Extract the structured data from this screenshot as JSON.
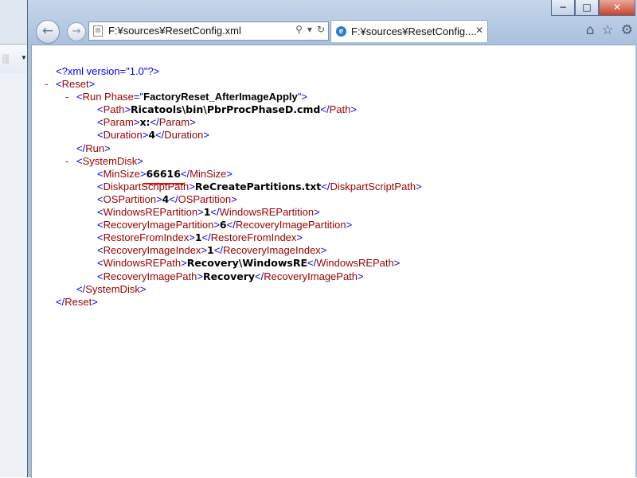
{
  "browser": {
    "address": "F:¥sources¥ResetConfig.xml",
    "tab_title": "F:¥sources¥ResetConfig....",
    "window_controls": [
      "minimize",
      "maximize",
      "close"
    ],
    "right_icons": [
      "home-icon",
      "star-icon",
      "gear-icon"
    ]
  },
  "xml": {
    "declaration": "<?xml version=\"1.0\"?>",
    "root": "Reset",
    "run": {
      "tag": "Run",
      "attr_name": "Phase",
      "attr_value": "FactoryReset_AfterImageApply",
      "children": [
        {
          "tag": "Path",
          "value": "Ricatools\\bin\\PbrProcPhaseD.cmd"
        },
        {
          "tag": "Param",
          "value": "x:"
        },
        {
          "tag": "Duration",
          "value": "4"
        }
      ]
    },
    "systemdisk": {
      "tag": "SystemDisk",
      "children": [
        {
          "tag": "MinSize",
          "value": "66616",
          "highlighted": true
        },
        {
          "tag": "DiskpartScriptPath",
          "value": "ReCreatePartitions.txt"
        },
        {
          "tag": "OSPartition",
          "value": "4"
        },
        {
          "tag": "WindowsREPartition",
          "value": "1"
        },
        {
          "tag": "RecoveryImagePartition",
          "value": "6"
        },
        {
          "tag": "RestoreFromIndex",
          "value": "1"
        },
        {
          "tag": "RecoveryImageIndex",
          "value": "1"
        },
        {
          "tag": "WindowsREPath",
          "value": "Recovery\\WindowsRE"
        },
        {
          "tag": "RecoveryImagePath",
          "value": "Recovery"
        }
      ]
    }
  },
  "colors": {
    "bracket": "#0000ff",
    "element": "#990000",
    "collapse_marker": "#e00000",
    "highlight_underline": "#e01010"
  }
}
